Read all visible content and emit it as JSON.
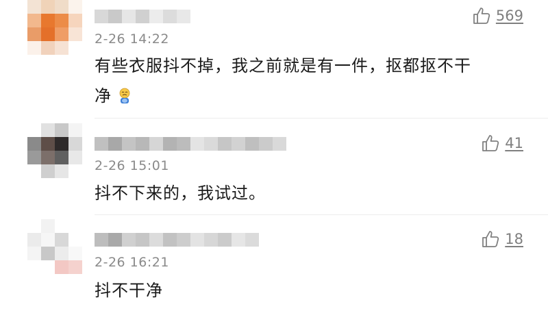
{
  "comments": [
    {
      "time": "2-26 14:22",
      "text": "有些衣服抖不掉，我之前就是有一件，抠都抠不干",
      "text_line2": "净",
      "likes": "569",
      "emoji": "crying-face-emoji"
    },
    {
      "time": "2-26 15:01",
      "text": "抖不下来的，我试过。",
      "likes": "41"
    },
    {
      "time": "2-26 16:21",
      "text": "抖不干净",
      "likes": "18"
    }
  ],
  "icons": {
    "like": "thumbs-up-icon"
  },
  "colors": {
    "time": "#8a8a8a",
    "text": "#1a1a1a",
    "like": "#7f7f7f"
  }
}
